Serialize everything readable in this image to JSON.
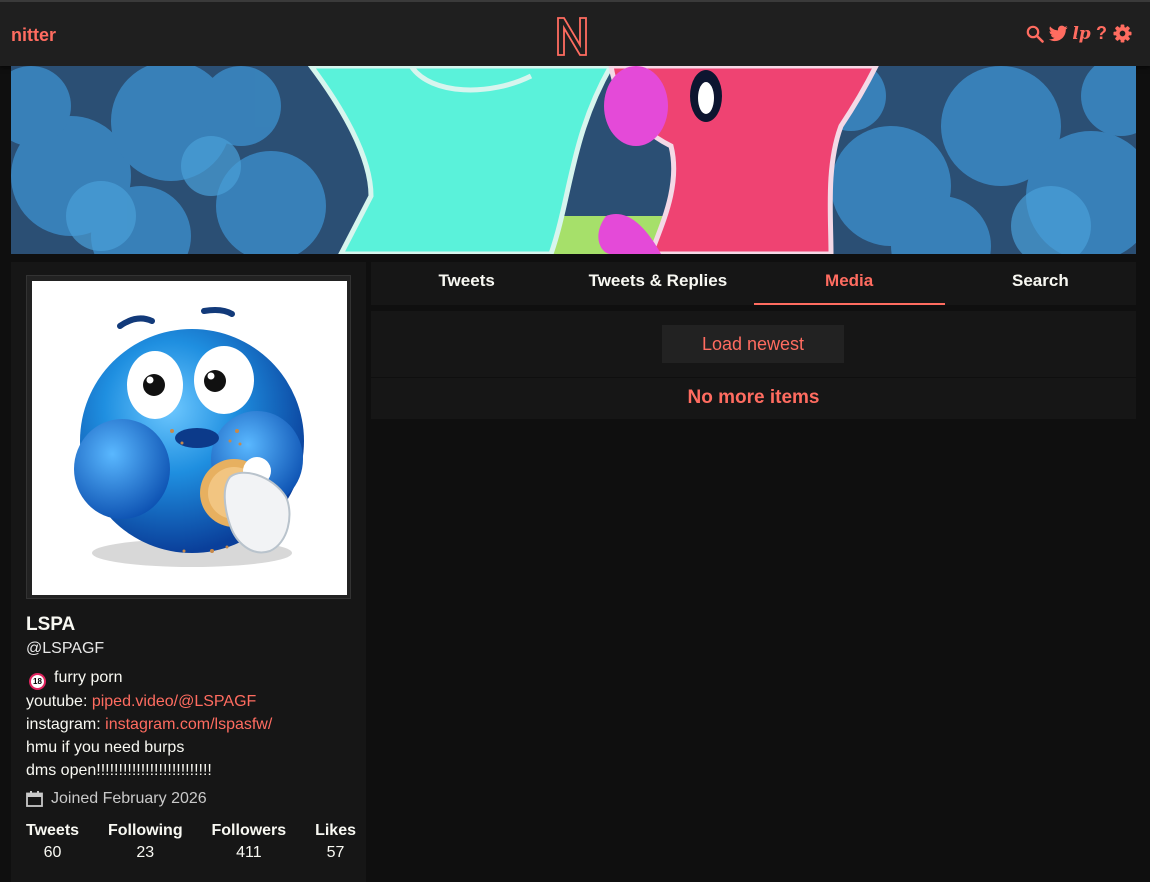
{
  "navbar": {
    "site_name": "nitter",
    "icons": [
      "search-icon",
      "twitter-bird-icon",
      "lp-icon",
      "help-icon",
      "gear-icon"
    ],
    "lp_glyph": "lp",
    "help_glyph": "?"
  },
  "colors": {
    "accent": "#ff6c60",
    "background": "#0f0f0f",
    "panel": "#161616",
    "navbar": "#1f1f1f"
  },
  "profile": {
    "fullname": "LSPA",
    "username": "@LSPAGF",
    "bio": {
      "badge": "18",
      "line1_text": "furry porn",
      "line2_prefix": "youtube: ",
      "line2_link": "piped.video/@LSPAGF",
      "line3_prefix": "instagram: ",
      "line3_link": "instagram.com/lspasfw/",
      "line4": "hmu if you need burps",
      "line5": "dms open!!!!!!!!!!!!!!!!!!!!!!!!!!"
    },
    "joined": "Joined February 2026",
    "stats": [
      {
        "label": "Tweets",
        "value": "60"
      },
      {
        "label": "Following",
        "value": "23"
      },
      {
        "label": "Followers",
        "value": "411"
      },
      {
        "label": "Likes",
        "value": "57"
      }
    ]
  },
  "tabs": [
    {
      "label": "Tweets"
    },
    {
      "label": "Tweets & Replies"
    },
    {
      "label": "Media",
      "active": true
    },
    {
      "label": "Search"
    }
  ],
  "timeline": {
    "load_newest": "Load newest",
    "end_message": "No more items"
  }
}
